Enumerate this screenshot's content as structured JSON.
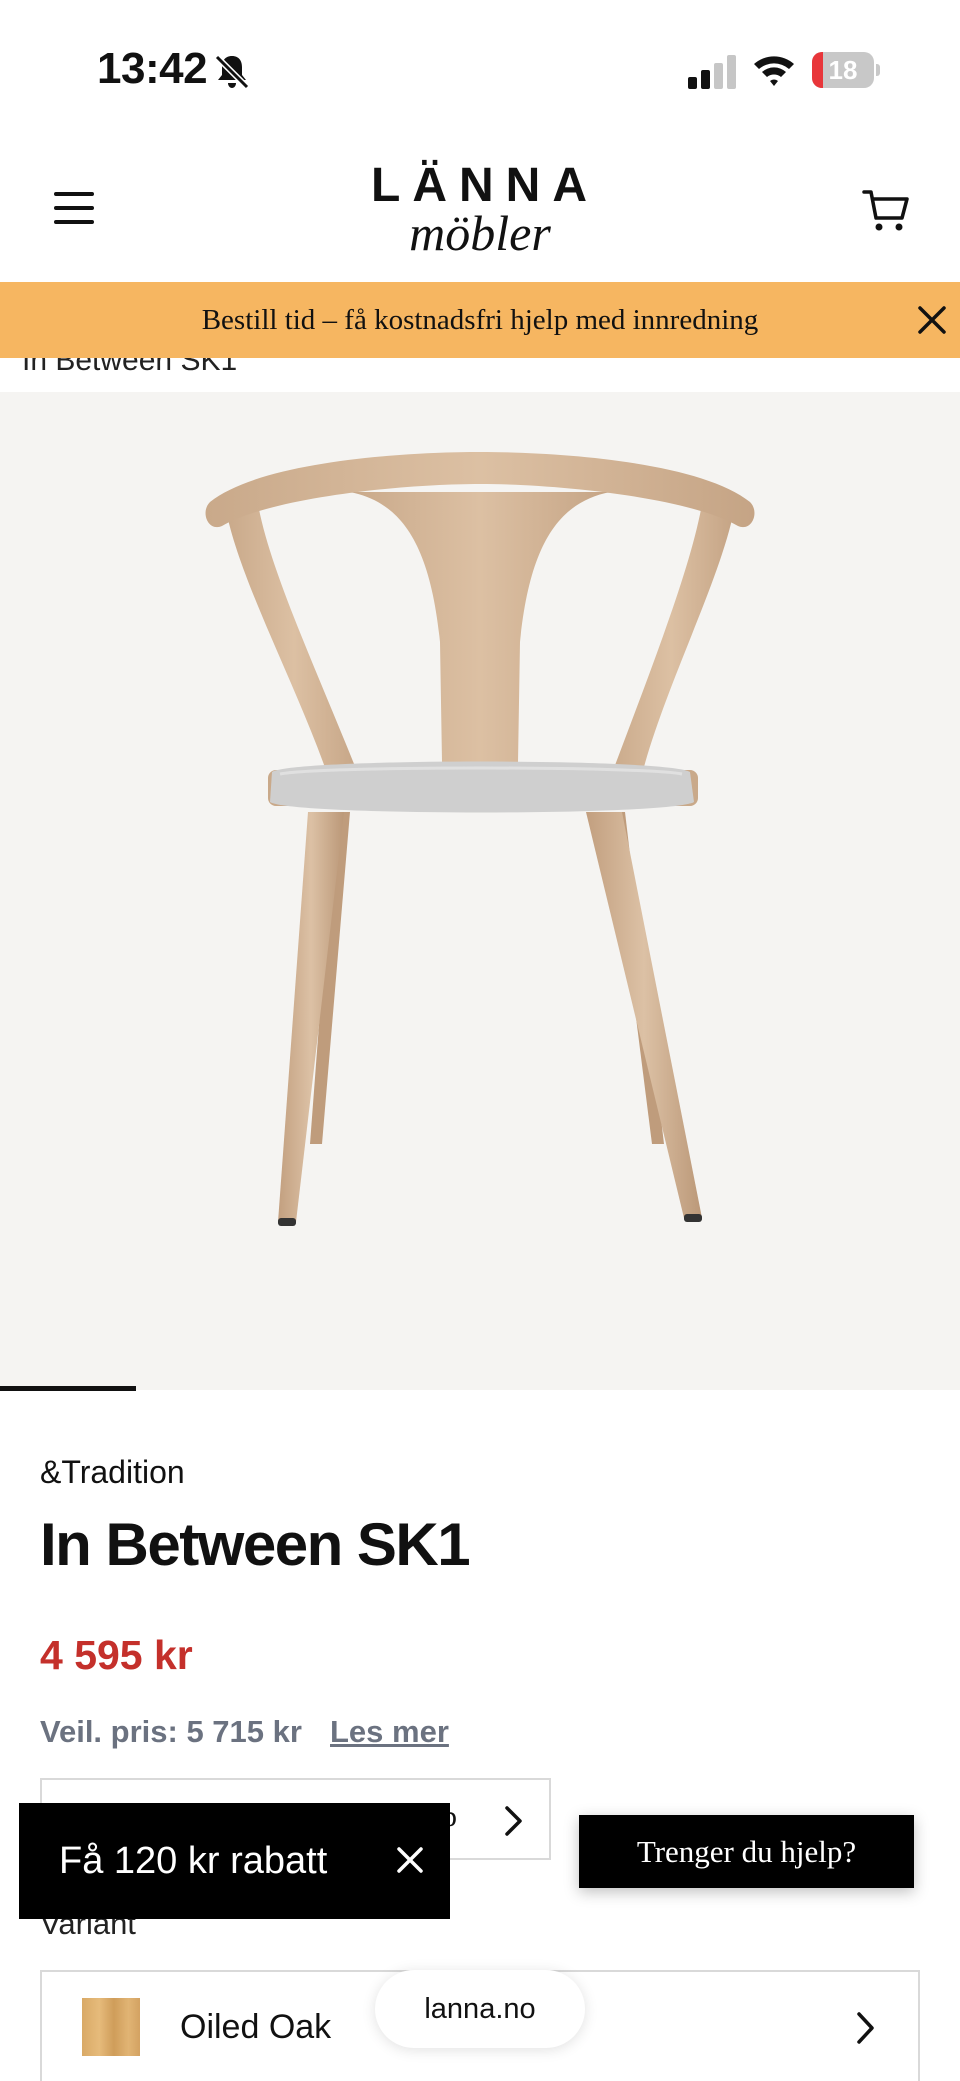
{
  "status_bar": {
    "time": "13:42",
    "battery_level": "18",
    "battery_fraction": 0.18
  },
  "header": {
    "logo_top": "LÄNNA",
    "logo_bottom": "möbler"
  },
  "banner": {
    "text": "Bestill tid – få kostnadsfri hjelp med innredning"
  },
  "breadcrumb": {
    "current": "In Between SK1"
  },
  "gallery": {
    "current_index": 1
  },
  "product": {
    "brand": "&Tradition",
    "title": "In Between SK1",
    "price": "4 595 kr",
    "recommended_price": "Veil. pris: 5 715 kr",
    "read_more": "Les mer",
    "select_partial_text": "p",
    "variant_label": "Variant",
    "variant_value": "Oiled Oak"
  },
  "discount_popup": {
    "text": "Få 120 kr rabatt"
  },
  "help_button": {
    "label": "Trenger du hjelp?"
  },
  "browser": {
    "url": "lanna.no"
  },
  "colors": {
    "banner_bg": "#f6b661",
    "price": "#c4302b",
    "muted": "#6b7280",
    "image_bg": "#f5f4f2"
  }
}
